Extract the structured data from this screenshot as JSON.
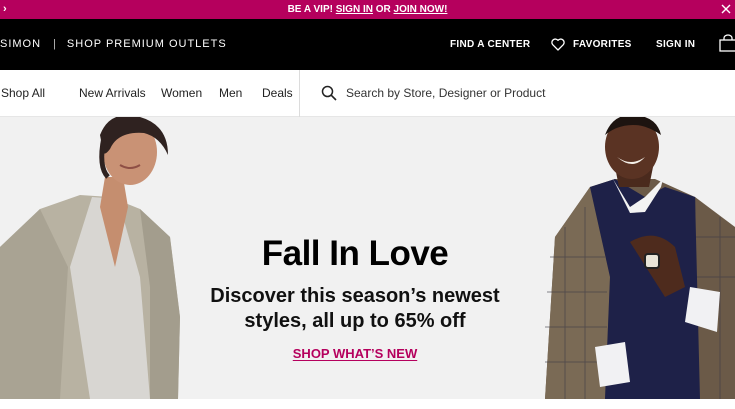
{
  "promo": {
    "prefix": "BE A VIP! ",
    "sign_in": "SIGN IN",
    "middle": " OR ",
    "join": "JOIN NOW!",
    "arrow": "›"
  },
  "header": {
    "brand": "SIMON",
    "separator": "|",
    "site_name": "SHOP PREMIUM OUTLETS",
    "find_center": "FIND A CENTER",
    "favorites": "FAVORITES",
    "sign_in": "SIGN IN"
  },
  "nav": {
    "items": [
      "Shop All",
      "New Arrivals",
      "Women",
      "Men",
      "Deals"
    ],
    "search_placeholder": "Search by Store, Designer or Product"
  },
  "hero": {
    "title": "Fall In Love",
    "subtitle": "Discover this season’s newest styles, all up to 65% off",
    "cta": "SHOP WHAT’S NEW"
  },
  "colors": {
    "accent": "#b5005d",
    "header_bg": "#000000",
    "hero_bg": "#f1f1f1"
  },
  "icons": [
    "chevron-right-icon",
    "close-icon",
    "heart-icon",
    "shopping-bag-icon",
    "search-icon"
  ]
}
